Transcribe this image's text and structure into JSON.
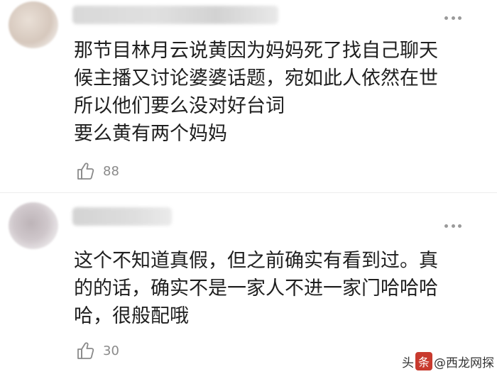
{
  "comments": [
    {
      "text_lines": [
        "那节目林月云说黄因为妈妈死了找自己聊天",
        "候主播又讨论婆婆话题，宛如此人依然在世",
        "所以他们要么没对好台词",
        "要么黄有两个妈妈"
      ],
      "likes": "88"
    },
    {
      "text_lines": [
        "这个不知道真假，但之前确实有看到过。真",
        "的的话，确实不是一家人不进一家门哈哈哈",
        "哈，很般配哦"
      ],
      "likes": "30"
    }
  ],
  "watermark": {
    "prefix": "头",
    "badge": "条",
    "suffix": "@西龙网探"
  },
  "icons": {
    "like": "thumbs-up-icon",
    "more": "more-dots-icon"
  },
  "colors": {
    "text": "#1f1f1f",
    "meta": "#8a8a8a",
    "watermark_badge": "#c83a2e"
  }
}
